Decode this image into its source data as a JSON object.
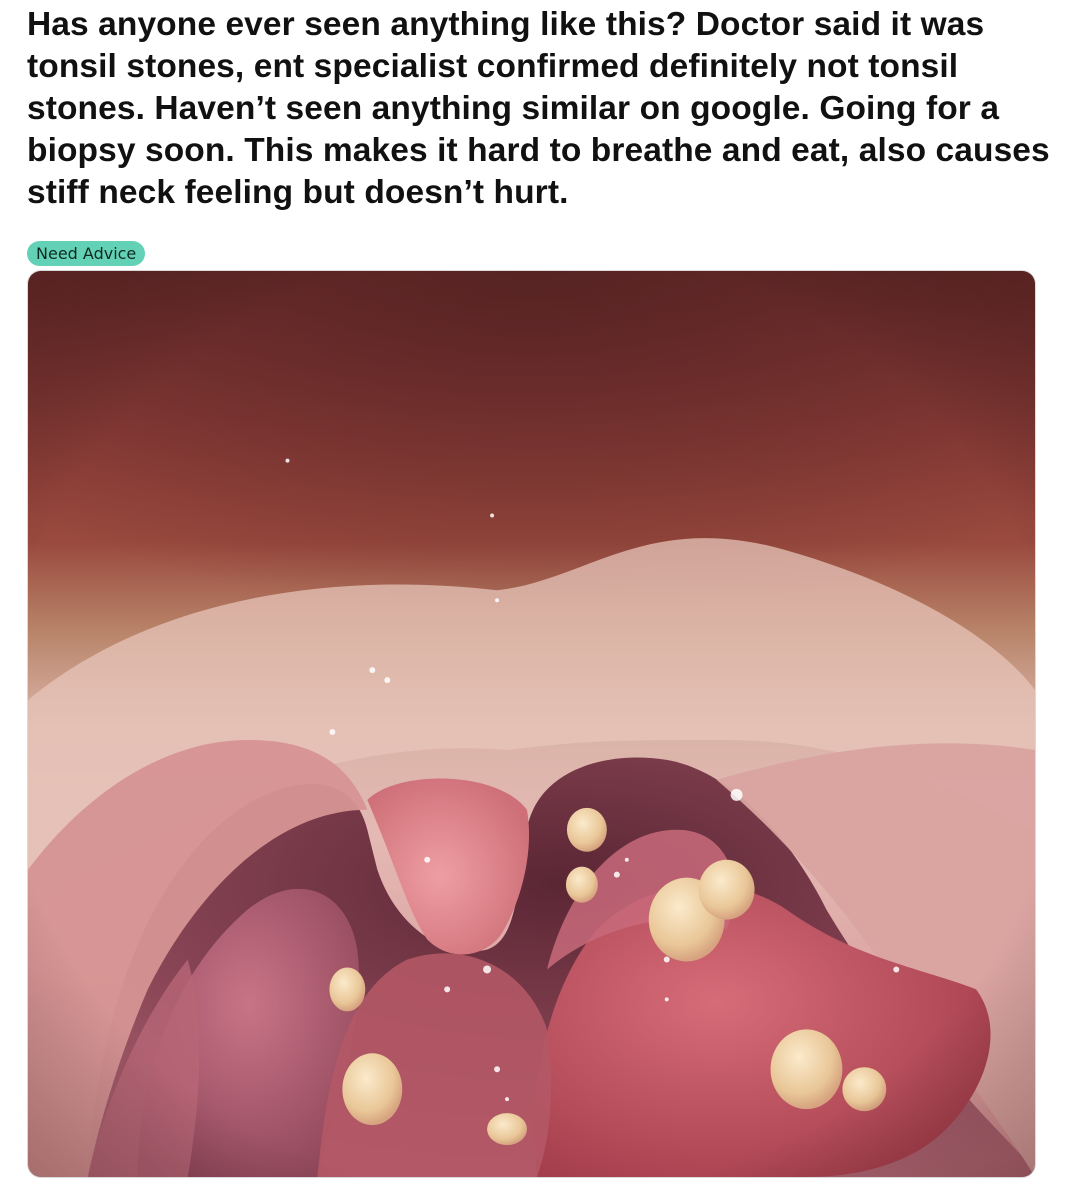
{
  "post": {
    "title": "Has anyone ever seen anything like this? Doctor said it was tonsil stones, ent specialist confirmed definitely not tonsil stones. Haven’t seen anything similar on google. Going for a biopsy soon. This makes it hard to breathe and eat, also causes stiff neck feeling but doesn’t hurt.",
    "flair": {
      "label": "Need Advice",
      "color": "#63d1b5"
    }
  },
  "colors": {
    "background": "#ffffff",
    "text": "#111111"
  }
}
